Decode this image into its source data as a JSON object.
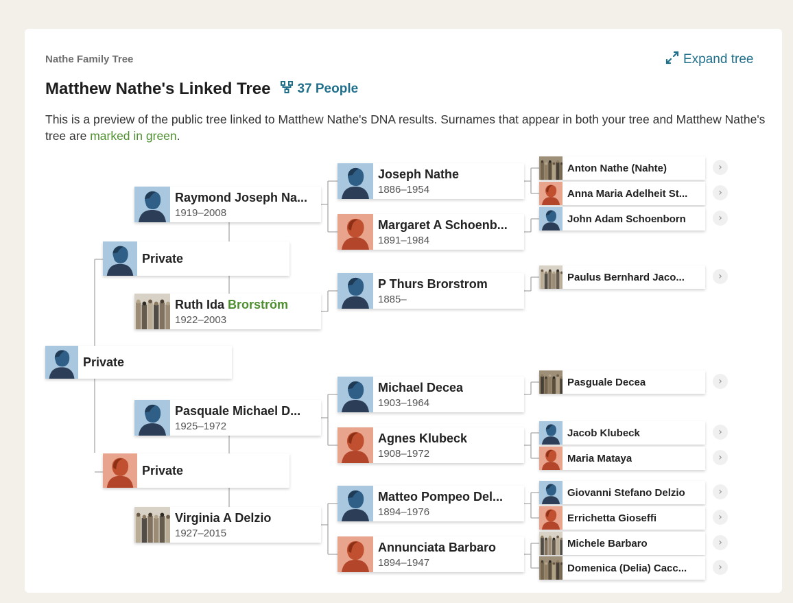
{
  "header": {
    "tree_label": "Nathe Family Tree",
    "expand_label": "Expand tree",
    "title": "Matthew Nathe's Linked Tree",
    "people_count": "37 People",
    "desc_before": "This is a preview of the public tree linked to Matthew Nathe's DNA results. Surnames that appear in both your tree and Matthew Nathe's tree are ",
    "desc_green": "marked in green",
    "desc_after": "."
  },
  "colors": {
    "link": "#1f6f8b",
    "match_green": "#4d8f2e",
    "male_bg": "#a9c7df",
    "female_bg": "#e8a48c"
  },
  "gen0": {
    "name": "Private"
  },
  "gen1": [
    {
      "name": "Private",
      "gender": "male"
    },
    {
      "name": "Private",
      "gender": "female"
    }
  ],
  "gen2": [
    {
      "name": "Raymond Joseph Na...",
      "dates": "1919–2008",
      "gender": "male"
    },
    {
      "name_before": "Ruth Ida ",
      "name_green": "Brorström",
      "dates": "1922–2003",
      "photo": true
    },
    {
      "name": "Pasquale Michael D...",
      "dates": "1925–1972",
      "gender": "male"
    },
    {
      "name": "Virginia A Delzio",
      "dates": "1927–2015",
      "photo": true
    }
  ],
  "gen3": [
    {
      "name": "Joseph Nathe",
      "dates": "1886–1954",
      "gender": "male"
    },
    {
      "name": "Margaret A Schoenb...",
      "dates": "1891–1984",
      "gender": "female"
    },
    {
      "name": "P Thurs Brorstrom",
      "dates": "1885–",
      "gender": "male"
    },
    {
      "name": "Michael Decea",
      "dates": "1903–1964",
      "gender": "male"
    },
    {
      "name": "Agnes Klubeck",
      "dates": "1908–1972",
      "gender": "female"
    },
    {
      "name": "Matteo Pompeo Del...",
      "dates": "1894–1976",
      "gender": "male"
    },
    {
      "name": "Annunciata Barbaro",
      "dates": "1894–1947",
      "gender": "female"
    }
  ],
  "gen4": [
    {
      "name": "Anton Nathe (Nahte)",
      "photo": true
    },
    {
      "name": "Anna Maria Adelheit St...",
      "gender": "female"
    },
    {
      "name": "John Adam Schoenborn",
      "gender": "male"
    },
    {
      "name": "Paulus Bernhard Jaco...",
      "photo": true
    },
    {
      "name": "Pasguale Decea",
      "photo": true
    },
    {
      "name": "Jacob Klubeck",
      "gender": "male"
    },
    {
      "name": "Maria Mataya",
      "gender": "female"
    },
    {
      "name": "Giovanni Stefano Delzio",
      "gender": "male"
    },
    {
      "name": "Errichetta Gioseffi",
      "gender": "female"
    },
    {
      "name": "Michele Barbaro",
      "photo": true
    },
    {
      "name": "Domenica (Delia) Cacc...",
      "photo": true
    }
  ],
  "icons": {
    "expand": "expand-arrows-icon",
    "people": "tree-structure-icon",
    "chevron": "chevron-right-icon"
  }
}
